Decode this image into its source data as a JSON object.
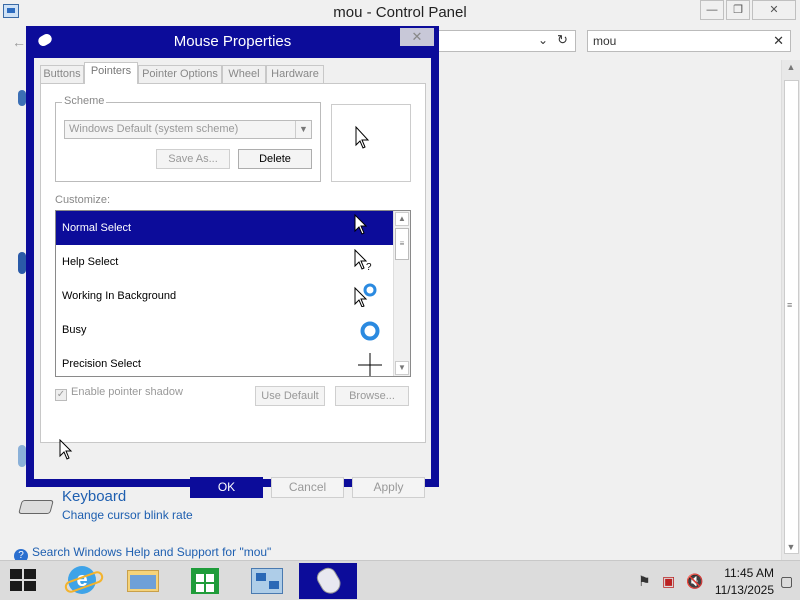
{
  "control_panel": {
    "title": "mou - Control Panel",
    "search_value": "mou",
    "keyboard_title": "Keyboard",
    "keyboard_subtitle": "Change cursor blink rate",
    "help_link": "Search Windows Help and Support for \"mou\""
  },
  "dialog": {
    "title": "Mouse Properties",
    "tabs": [
      "Buttons",
      "Pointers",
      "Pointer Options",
      "Wheel",
      "Hardware"
    ],
    "active_tab": "Pointers",
    "scheme_label": "Scheme",
    "scheme_value": "Windows Default (system scheme)",
    "save_as_label": "Save As...",
    "delete_label": "Delete",
    "customize_label": "Customize:",
    "cursor_items": [
      {
        "label": "Normal Select",
        "icon": "arrow-cursor-icon",
        "selected": true
      },
      {
        "label": "Help Select",
        "icon": "help-cursor-icon",
        "selected": false
      },
      {
        "label": "Working In Background",
        "icon": "working-cursor-icon",
        "selected": false
      },
      {
        "label": "Busy",
        "icon": "busy-cursor-icon",
        "selected": false
      },
      {
        "label": "Precision Select",
        "icon": "crosshair-cursor-icon",
        "selected": false
      }
    ],
    "enable_shadow_label": "Enable pointer shadow",
    "enable_shadow_checked": true,
    "use_default_label": "Use Default",
    "browse_label": "Browse...",
    "ok_label": "OK",
    "cancel_label": "Cancel",
    "apply_label": "Apply"
  },
  "taskbar": {
    "time": "11:45 AM",
    "date": "11/13/2025"
  },
  "colors": {
    "dialog_frame": "#0c0c9a",
    "selection": "#0c0c9a",
    "link": "#1e5fb0"
  }
}
